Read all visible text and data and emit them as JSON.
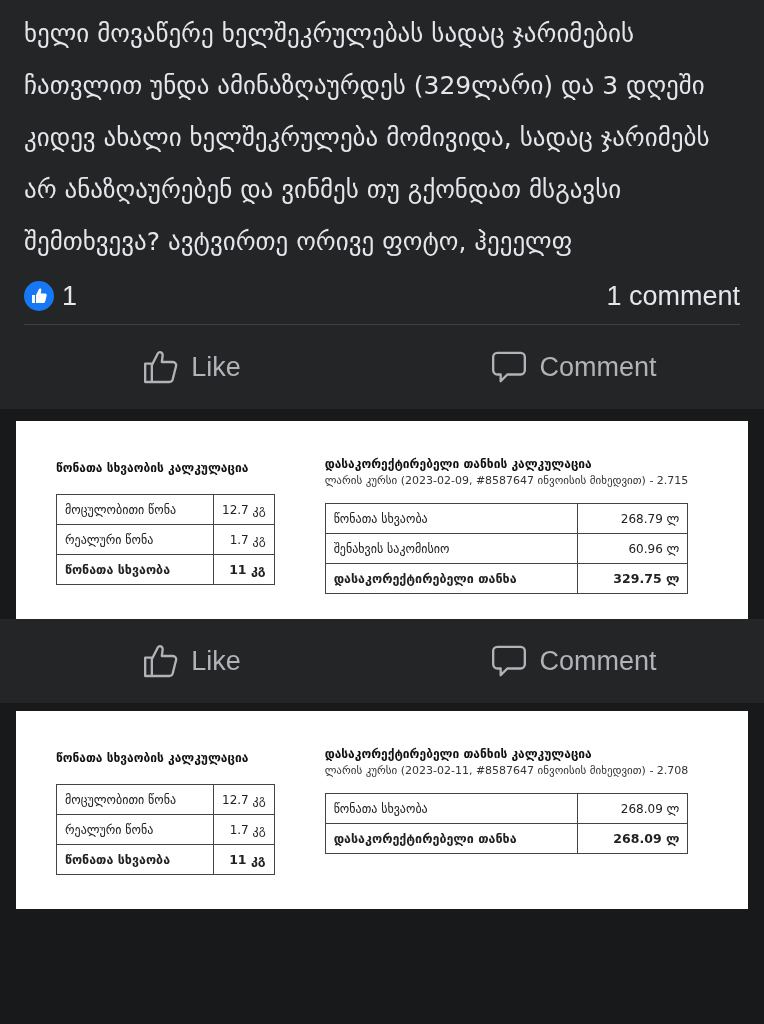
{
  "post": {
    "text": "ხელი მოვაწერე ხელშეკრულებას სადაც ჯარიმების ჩათვლით უნდა ამინაზღაურდეს (329ლარი) და 3 დღეში კიდევ ახალი ხელშეკრულება მომივიდა, სადაც ჯარიმებს არ ანაზღაურებენ და ვინმეს თუ გქონდათ მსგავსი შემთხვევა? ავტვირთე ორივე ფოტო, ჰეეელფ",
    "reaction_count": "1",
    "comment_count": "1 comment",
    "actions": [
      "Like",
      "Comment"
    ]
  },
  "photos": [
    {
      "left": {
        "title": "წონათა სხვაობის კალკულაცია",
        "rows": [
          {
            "label": "მოცულობითი წონა",
            "value": "12.7 კგ",
            "kind": "normal"
          },
          {
            "label": "რეალური წონა",
            "value": "1.7 კგ",
            "kind": "normal"
          },
          {
            "label": "წონათა სხვაობა",
            "value": "11 კგ",
            "kind": "total"
          }
        ]
      },
      "right": {
        "title": "დასაკორექტირებელი თანხის კალკულაცია",
        "subtitle": "ლარის კურსი (2023-02-09, #8587647 ინვოისის მიხედვით) - 2.715",
        "rows": [
          {
            "label": "წონათა სხვაობა",
            "value": "268.79 ლ",
            "kind": "normal"
          },
          {
            "label": "შენახვის საკომისიო",
            "value": "60.96 ლ",
            "kind": "normal"
          },
          {
            "label": "დასაკორექტირებელი თანხა",
            "value": "329.75 ლ",
            "kind": "total"
          }
        ]
      },
      "actions": [
        "Like",
        "Comment"
      ]
    },
    {
      "left": {
        "title": "წონათა სხვაობის კალკულაცია",
        "rows": [
          {
            "label": "მოცულობითი წონა",
            "value": "12.7 კგ",
            "kind": "normal"
          },
          {
            "label": "რეალური წონა",
            "value": "1.7 კგ",
            "kind": "normal"
          },
          {
            "label": "წონათა სხვაობა",
            "value": "11 კგ",
            "kind": "total"
          }
        ]
      },
      "right": {
        "title": "დასაკორექტირებელი თანხის კალკულაცია",
        "subtitle": "ლარის კურსი (2023-02-11, #8587647 ინვოისის მიხედვით) - 2.708",
        "rows": [
          {
            "label": "წონათა სხვაობა",
            "value": "268.09 ლ",
            "kind": "normal"
          },
          {
            "label": "დასაკორექტირებელი თანხა",
            "value": "268.09 ლ",
            "kind": "total"
          }
        ]
      }
    }
  ]
}
